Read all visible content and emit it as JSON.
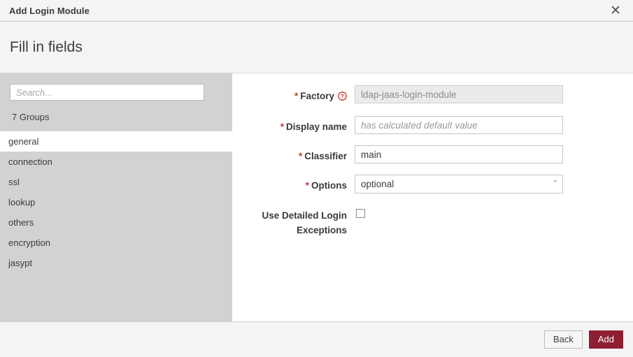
{
  "titlebar": {
    "title": "Add Login Module",
    "close_icon": "close-icon",
    "close_glyph": "✕"
  },
  "header": {
    "title": "Fill in fields"
  },
  "sidebar": {
    "search": {
      "value": "",
      "placeholder": "Search..."
    },
    "groups_count_label": "7 Groups",
    "items": [
      {
        "label": "general",
        "selected": true
      },
      {
        "label": "connection",
        "selected": false
      },
      {
        "label": "ssl",
        "selected": false
      },
      {
        "label": "lookup",
        "selected": false
      },
      {
        "label": "others",
        "selected": false
      },
      {
        "label": "encryption",
        "selected": false
      },
      {
        "label": "jasypt",
        "selected": false
      }
    ]
  },
  "form": {
    "fields": [
      {
        "label": "Factory",
        "required_marker": "*",
        "help_icon": "help-circle-icon",
        "type": "text",
        "value": "ldap-jaas-login-module",
        "placeholder": "",
        "disabled": true
      },
      {
        "label": "Display name",
        "required_marker": "*",
        "type": "text",
        "value": "",
        "placeholder": "has calculated default value",
        "disabled": false
      },
      {
        "label": "Classifier",
        "required_marker": "*",
        "type": "text",
        "value": "main",
        "placeholder": "",
        "disabled": false
      },
      {
        "label": "Options",
        "required_marker": "*",
        "type": "select",
        "value": "optional",
        "options": [
          "optional"
        ],
        "arrow_glyph": "ˇ"
      },
      {
        "label": "Use Detailed Login Exceptions",
        "required_marker": "",
        "type": "checkbox",
        "checked": false
      }
    ]
  },
  "footer": {
    "back_label": "Back",
    "add_label": "Add"
  },
  "colors": {
    "accent": "#8e1f32",
    "required_star": "#c0392b",
    "sidebar_bg": "#d2d2d2",
    "band_bg": "#f4f4f4"
  }
}
